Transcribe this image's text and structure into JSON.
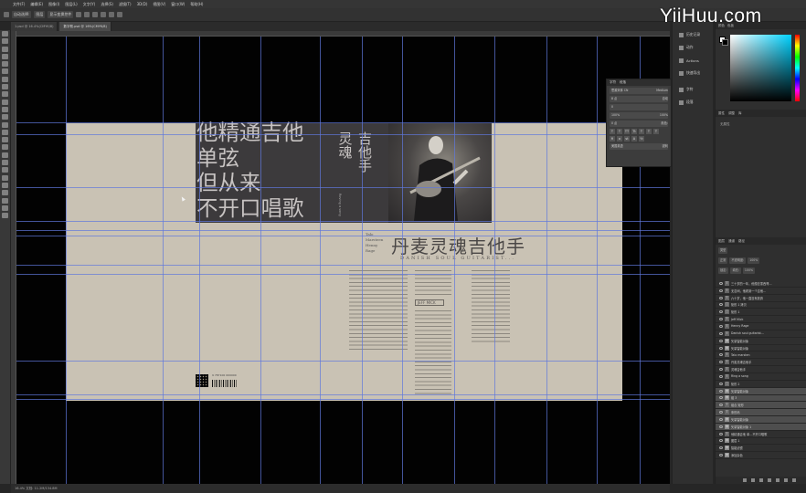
{
  "app": {
    "logo": "Ps"
  },
  "watermark": "YiiHuu.com",
  "menu": [
    "文件(F)",
    "编辑(E)",
    "图像(I)",
    "图层(L)",
    "文字(Y)",
    "选择(S)",
    "滤镜(T)",
    "3D(D)",
    "视图(V)",
    "窗口(W)",
    "帮助(H)"
  ],
  "options": {
    "auto_select": "自动选择:",
    "layer": "图层",
    "transform": "显示变换控件"
  },
  "tabs": [
    {
      "label": "1.psd @ 16.4%(CMYK/8)",
      "active": false
    },
    {
      "label": "数字叙.psd @ 16%(CMYK/8)",
      "active": true
    }
  ],
  "document": {
    "big_text": [
      "他精通吉他",
      "单弦",
      "但从来",
      "不开口唱歌"
    ],
    "vert_cols": [
      "灵魂",
      "吉他手"
    ],
    "vert_small": "Roving a song",
    "side_names": [
      "Talo",
      "Marsteen",
      "",
      "Henny",
      "Rage"
    ],
    "headline": "丹麦灵魂吉他手",
    "subhead": "DANISH SOUL GUITARIST...",
    "infobox": "JEFF MICK",
    "barcode_text": "9 787100 000000"
  },
  "char_panel": {
    "tabs": [
      "字符",
      "段落"
    ],
    "font": "思源宋体 CN",
    "style": "Medium",
    "size": "8 点",
    "leading": "自动",
    "tracking": "0",
    "scale_v": "100%",
    "scale_h": "100%",
    "baseline": "0 点",
    "color_label": "颜色:",
    "lang": "美国英语",
    "aa": "锐利"
  },
  "dock": [
    "历史记录",
    "动作",
    "Actions",
    "快速导出",
    "字符",
    "段落"
  ],
  "color_tabs": [
    "颜色",
    "色板"
  ],
  "colors": {
    "fg": "#ffffff",
    "bg": "#000000",
    "accent": "#31a8ff",
    "paper": "#c9c2b4",
    "dark": "#3c3a3c"
  },
  "props": {
    "tabs": [
      "属性",
      "调整",
      "库"
    ],
    "label": "无属性"
  },
  "layers_panel": {
    "tabs": [
      "图层",
      "通道",
      "路径"
    ],
    "kind": "类型",
    "blend": "正常",
    "opacity_label": "不透明度:",
    "opacity": "100%",
    "lock_label": "锁定:",
    "fill_label": "填充:",
    "fill": "100%",
    "layers": [
      {
        "name": "三十岁的一年，他想去墨西哥…",
        "kind": "T",
        "sel": false
      },
      {
        "name": "无意间，他看到一个吉他…",
        "kind": "T",
        "sel": false
      },
      {
        "name": "六十岁，他一直没有放弃",
        "kind": "T",
        "sel": false
      },
      {
        "name": "矩形 1 拷贝",
        "kind": "□",
        "sel": false
      },
      {
        "name": "矩形 1",
        "kind": "□",
        "sel": false
      },
      {
        "name": "Jeff Mick",
        "kind": "T",
        "sel": false
      },
      {
        "name": "Henny Rage",
        "kind": "T",
        "sel": false
      },
      {
        "name": "Danish soul guitarist…",
        "kind": "T",
        "sel": false
      },
      {
        "name": "矢量智能对象",
        "kind": "▤",
        "sel": false
      },
      {
        "name": "矢量智能对象",
        "kind": "▤",
        "sel": false
      },
      {
        "name": "Talo marsten",
        "kind": "T",
        "sel": false
      },
      {
        "name": "丹麦灵魂吉他手",
        "kind": "T",
        "sel": false
      },
      {
        "name": "灵魂吉他手",
        "kind": "T",
        "sel": false
      },
      {
        "name": "Ring a song",
        "kind": "T",
        "sel": false
      },
      {
        "name": "矩形 2",
        "kind": "□",
        "sel": false
      },
      {
        "name": "矢量智能对象",
        "kind": "▤",
        "sel": true
      },
      {
        "name": "组 3",
        "kind": "▤",
        "sel": true
      },
      {
        "name": "组合 矩形",
        "kind": "T",
        "sel": true
      },
      {
        "name": "条形码",
        "kind": "T",
        "sel": true
      },
      {
        "name": "矢量智能对象",
        "kind": "▤",
        "sel": true
      },
      {
        "name": "矢量智能对象 1",
        "kind": "▤",
        "sel": true
      },
      {
        "name": "他精通吉他 单…不开口唱歌",
        "kind": "T",
        "sel": false
      },
      {
        "name": "图层 1",
        "kind": "▤",
        "sel": false
      },
      {
        "name": "智能滤镜",
        "kind": "▤",
        "sel": false
      },
      {
        "name": "添加杂色",
        "kind": "▤",
        "sel": false
      }
    ]
  },
  "status": "16.4%    文档: 11.2M/134.8M"
}
